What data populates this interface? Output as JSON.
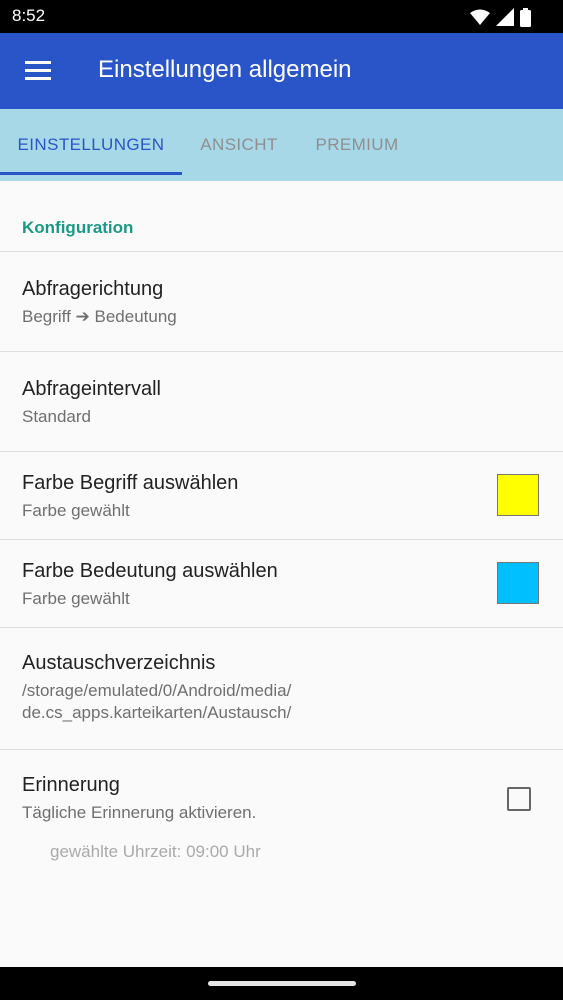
{
  "status_bar": {
    "time": "8:52"
  },
  "app_bar": {
    "title": "Einstellungen allgemein"
  },
  "tabs": [
    {
      "label": "EINSTELLUNGEN",
      "selected": true
    },
    {
      "label": "ANSICHT",
      "selected": false
    },
    {
      "label": "PREMIUM",
      "selected": false
    }
  ],
  "colors": {
    "primary": "#2a55c8",
    "tab_bar": "#a7d8e7",
    "accent": "#1a9a86"
  },
  "section": {
    "title": "Konfiguration"
  },
  "preferences": {
    "direction": {
      "title": "Abfragerichtung",
      "summary": "Begriff ➔ Bedeutung"
    },
    "interval": {
      "title": "Abfrageintervall",
      "summary": "Standard"
    },
    "term_color": {
      "title": "Farbe Begriff auswählen",
      "summary": "Farbe gewählt",
      "color": "#ffff00"
    },
    "meaning_color": {
      "title": "Farbe Bedeutung auswählen",
      "summary": "Farbe gewählt",
      "color": "#00bfff"
    },
    "exchange_dir": {
      "title": "Austauschverzeichnis",
      "summary_line1": "/storage/emulated/0/Android/media/",
      "summary_line2": "de.cs_apps.karteikarten/Austausch/"
    },
    "reminder": {
      "title": "Erinnerung",
      "summary": "Tägliche Erinnerung aktivieren.",
      "checked": false,
      "time_info": "gewählte Uhrzeit: 09:00 Uhr"
    }
  }
}
